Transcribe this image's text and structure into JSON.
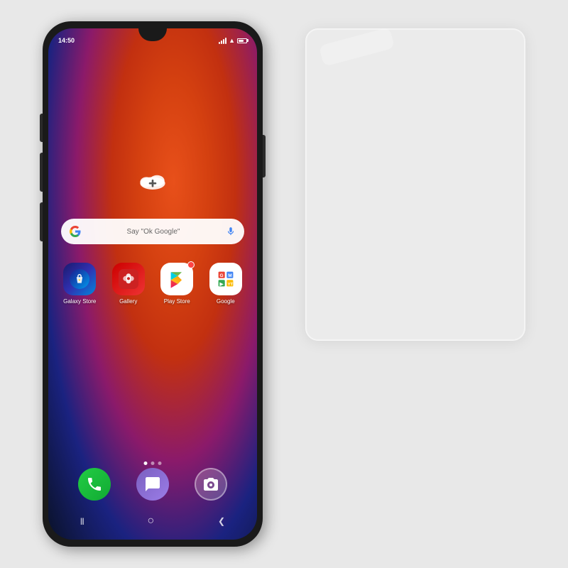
{
  "scene": {
    "bg_color": "#e0e0e0"
  },
  "phone": {
    "status": {
      "time": "14:50",
      "battery": "70"
    },
    "search_bar": {
      "placeholder": "Say \"Ok Google\"",
      "google_label": "G"
    },
    "apps_row1": [
      {
        "id": "galaxy-store",
        "label": "Galaxy Store",
        "icon_type": "galaxy-store"
      },
      {
        "id": "gallery",
        "label": "Gallery",
        "icon_type": "gallery"
      },
      {
        "id": "play-store",
        "label": "Play Store",
        "icon_type": "play-store"
      },
      {
        "id": "google",
        "label": "Google",
        "icon_type": "google"
      }
    ],
    "dock": [
      {
        "id": "phone",
        "label": "Phone",
        "icon_type": "phone"
      },
      {
        "id": "messages",
        "label": "Messages",
        "icon_type": "messages"
      },
      {
        "id": "camera",
        "label": "Camera",
        "icon_type": "camera"
      }
    ],
    "nav": {
      "back": "❮",
      "home": "○",
      "recent": "|||"
    }
  },
  "screen_protector": {
    "label": "Screen Protector"
  }
}
